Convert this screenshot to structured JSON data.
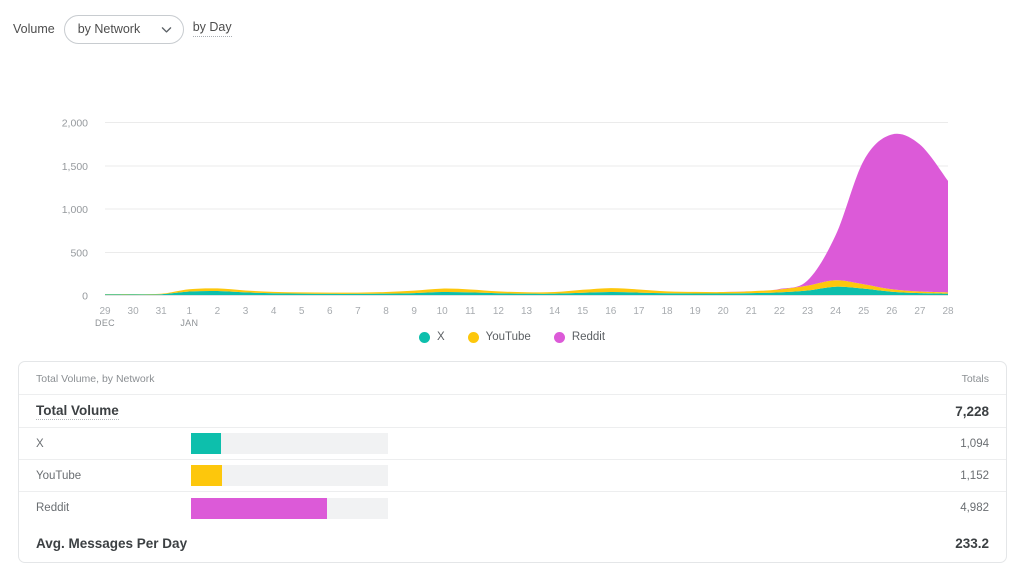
{
  "toolbar": {
    "metric_label": "Volume",
    "network_select": {
      "value": "by Network",
      "icon": "chevron-down-icon"
    },
    "interval_link": "by Day"
  },
  "colors": {
    "x": "#0dbfac",
    "youtube": "#fdc70c",
    "reddit": "#dc5ad8",
    "grid": "#ebebeb",
    "track": "#f1f2f3"
  },
  "legend": {
    "items": [
      {
        "label": "X",
        "color": "#0dbfac"
      },
      {
        "label": "YouTube",
        "color": "#fdc70c"
      },
      {
        "label": "Reddit",
        "color": "#dc5ad8"
      }
    ]
  },
  "chart_data": {
    "type": "area",
    "stacked": true,
    "title": "",
    "xlabel": "",
    "ylabel": "",
    "ylim": [
      0,
      2000
    ],
    "yticks": [
      0,
      500,
      1000,
      1500,
      2000
    ],
    "ytick_labels": [
      "0",
      "500",
      "1,000",
      "1,500",
      "2,000"
    ],
    "grid": true,
    "legend_position": "bottom",
    "x": [
      "29",
      "30",
      "31",
      "1",
      "2",
      "3",
      "4",
      "5",
      "6",
      "7",
      "8",
      "9",
      "10",
      "11",
      "12",
      "13",
      "14",
      "15",
      "16",
      "17",
      "18",
      "19",
      "20",
      "21",
      "22",
      "23",
      "24",
      "25",
      "26",
      "27",
      "28"
    ],
    "x_month_labels": [
      {
        "index": 0,
        "label": "DEC"
      },
      {
        "index": 3,
        "label": "JAN"
      }
    ],
    "series": [
      {
        "name": "X",
        "color": "#0dbfac",
        "values": [
          8,
          8,
          9,
          40,
          46,
          30,
          20,
          16,
          14,
          14,
          16,
          22,
          34,
          30,
          20,
          16,
          16,
          26,
          34,
          28,
          20,
          18,
          18,
          22,
          30,
          52,
          96,
          74,
          38,
          22,
          16
        ]
      },
      {
        "name": "YouTube",
        "color": "#fdc70c",
        "values": [
          4,
          4,
          5,
          26,
          30,
          22,
          16,
          14,
          14,
          14,
          18,
          28,
          40,
          34,
          22,
          16,
          18,
          34,
          46,
          36,
          22,
          18,
          16,
          22,
          34,
          56,
          74,
          50,
          28,
          18,
          14
        ]
      },
      {
        "name": "Reddit",
        "color": "#dc5ad8",
        "values": [
          0,
          0,
          0,
          0,
          0,
          0,
          0,
          0,
          0,
          0,
          0,
          0,
          0,
          0,
          0,
          0,
          0,
          0,
          0,
          0,
          0,
          0,
          0,
          0,
          6,
          60,
          520,
          1430,
          1790,
          1700,
          1290
        ]
      }
    ]
  },
  "table": {
    "caption": "Total Volume, by Network",
    "totals_header": "Totals",
    "total_row": {
      "label": "Total Volume",
      "value": "7,228"
    },
    "rows": [
      {
        "label": "X",
        "value": "1,094",
        "color": "#0dbfac",
        "pct": 15.1
      },
      {
        "label": "YouTube",
        "value": "1,152",
        "color": "#fdc70c",
        "pct": 15.9
      },
      {
        "label": "Reddit",
        "value": "4,982",
        "color": "#dc5ad8",
        "pct": 68.9
      }
    ],
    "avg_row": {
      "label": "Avg. Messages Per Day",
      "value": "233.2"
    }
  }
}
